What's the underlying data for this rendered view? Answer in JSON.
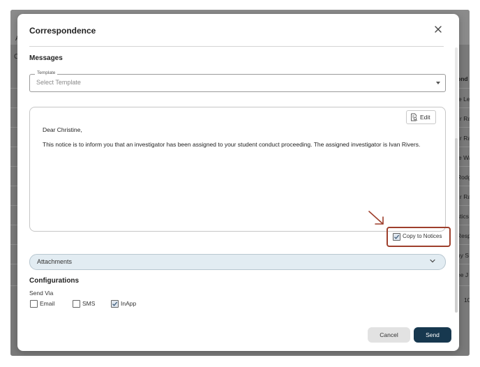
{
  "background": {
    "left_fragments": [
      "A",
      "C"
    ],
    "right_fragments": [
      "ond",
      "e Le",
      "r Ra",
      "r Ra",
      "e Wa",
      "Rodg",
      "r Ra",
      "stics",
      "Resp",
      "ny S",
      "ee J",
      "10"
    ]
  },
  "modal": {
    "title": "Correspondence",
    "messages_heading": "Messages",
    "template": {
      "legend": "Template",
      "placeholder": "Select Template"
    },
    "message": {
      "edit_label": "Edit",
      "greeting": "Dear Christine,",
      "body": "This notice is to inform you that an investigator has been assigned to your student conduct proceeding. The assigned investigator is Ivan Rivers."
    },
    "copy_to_notices": {
      "label": "Copy to Notices",
      "checked": true
    },
    "attachments_label": "Attachments",
    "configurations": {
      "heading": "Configurations",
      "send_via_label": "Send Via",
      "options": [
        {
          "label": "Email",
          "checked": false
        },
        {
          "label": "SMS",
          "checked": false
        },
        {
          "label": "InApp",
          "checked": true
        }
      ]
    },
    "buttons": {
      "cancel": "Cancel",
      "send": "Send"
    }
  },
  "colors": {
    "send_button": "#17384f",
    "annotation": "#9e3f2c",
    "attachments_bar": "#e2ecf2"
  }
}
